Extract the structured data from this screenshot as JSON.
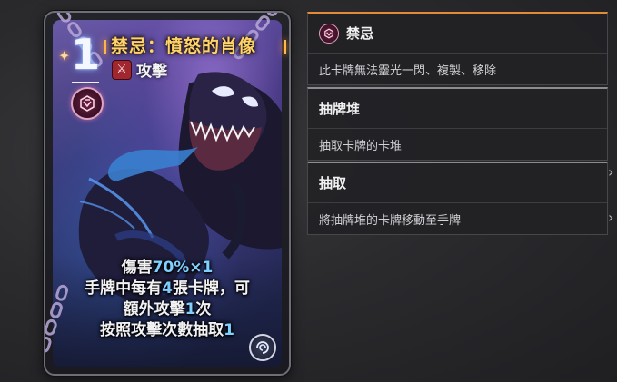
{
  "card": {
    "cost": "1",
    "title": "禁忌：憤怒的肖像",
    "type_icon": "crossed-swords-icon",
    "type_label": "攻擊",
    "badge_icon": "forbidden-sigil-icon",
    "element_icon": "swirl-element-icon",
    "text_lines": [
      {
        "parts": [
          {
            "t": "傷害",
            "hl": false
          },
          {
            "t": "70%×1",
            "hl": true
          }
        ]
      },
      {
        "parts": [
          {
            "t": "手牌中每有",
            "hl": false
          },
          {
            "t": "4",
            "hl": true
          },
          {
            "t": "張卡牌，可",
            "hl": false
          }
        ]
      },
      {
        "parts": [
          {
            "t": "額外攻擊",
            "hl": false
          },
          {
            "t": "1",
            "hl": true
          },
          {
            "t": "次",
            "hl": false
          }
        ]
      },
      {
        "parts": [
          {
            "t": "按照攻擊次數抽取",
            "hl": false
          },
          {
            "t": "1",
            "hl": true
          }
        ]
      }
    ],
    "colors": {
      "title": "#ffd36b",
      "highlight": "#7fd0ff",
      "type_icon_bg": "#a1262f"
    }
  },
  "keywords": [
    {
      "title": "禁忌",
      "desc": "此卡牌無法靈光一閃、複製、移除",
      "icon": "forbidden-sigil-icon",
      "accent": "#e08a3a"
    },
    {
      "title": "抽牌堆",
      "desc": "抽取卡牌的卡堆",
      "icon": "",
      "accent": "#8b8b90"
    },
    {
      "title": "抽取",
      "desc": "將抽牌堆的卡牌移動至手牌",
      "icon": "",
      "accent": "#8b8b90"
    }
  ]
}
